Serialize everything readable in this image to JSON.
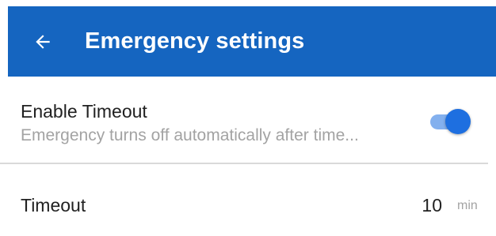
{
  "appbar": {
    "title": "Emergency settings",
    "back_icon": "arrow-left-icon",
    "color": "#1565c0"
  },
  "settings": {
    "enable_timeout": {
      "title": "Enable Timeout",
      "subtitle": "Emergency turns off automatically after time...",
      "enabled": true,
      "accent_color": "#1e6fe0"
    },
    "timeout": {
      "label": "Timeout",
      "value": "10",
      "unit": "min"
    }
  }
}
